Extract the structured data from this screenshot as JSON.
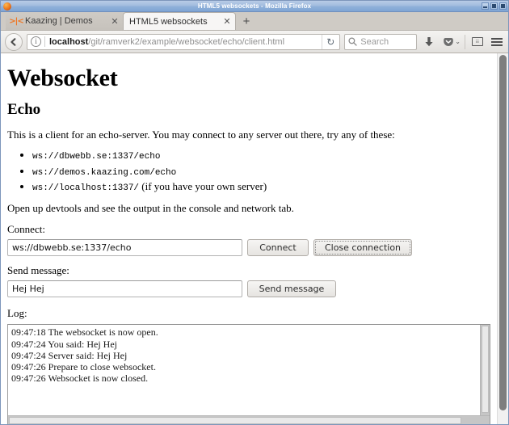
{
  "window": {
    "title": "HTML5 websockets - Mozilla Firefox",
    "minimize_label": "Minimize",
    "maximize_label": "Maximize",
    "close_label": "Close"
  },
  "tabs": [
    {
      "favicon": "kaazing-icon",
      "favicon_glyph": ">|<",
      "label": "Kaazing | Demos",
      "close_glyph": "✕",
      "active": false
    },
    {
      "favicon": "page-icon",
      "favicon_glyph": "",
      "label": "HTML5 websockets",
      "close_glyph": "✕",
      "active": true
    }
  ],
  "newtab": {
    "glyph": "+",
    "label": "New Tab"
  },
  "toolbar": {
    "back_label": "Back",
    "identity_glyph": "i",
    "url_host": "localhost",
    "url_path": "/git/ramverk2/example/websocket/echo/client.html",
    "reload_glyph": "↻",
    "reload_label": "Reload",
    "search_placeholder": "Search",
    "downloads_label": "Downloads",
    "pocket_label": "Save to Pocket",
    "pocket_chevron": "⌄",
    "reader_label": "Reader view",
    "reader_glyph": "☷",
    "menu_label": "Open menu"
  },
  "page": {
    "h1": "Websocket",
    "h2": "Echo",
    "intro": "This is a client for an echo-server. You may connect to any server out there, try any of these:",
    "servers": [
      {
        "url": "ws://dbwebb.se:1337/echo",
        "note": ""
      },
      {
        "url": "ws://demos.kaazing.com/echo",
        "note": ""
      },
      {
        "url": "ws://localhost:1337/",
        "note": "(if you have your own server)"
      }
    ],
    "devtools_note": "Open up devtools and see the output in the console and network tab.",
    "connect_label": "Connect:",
    "connect_value": "ws://dbwebb.se:1337/echo",
    "connect_placeholder": "",
    "connect_button": "Connect",
    "close_button": "Close connection",
    "send_label": "Send message:",
    "message_value": "Hej Hej",
    "message_placeholder": "",
    "send_button": "Send message",
    "log_label": "Log:",
    "log_lines": [
      "09:47:18 The websocket is now open.",
      "09:47:24 You said: Hej Hej",
      "09:47:24 Server said: Hej Hej",
      "09:47:26 Prepare to close websocket.",
      "09:47:26 Websocket is now closed."
    ]
  },
  "colors": {
    "titlebar_blue": "#8fb0d9",
    "tabstrip_gray": "#cfcbc5",
    "active_tab": "#f7f6f5",
    "kaazing_orange": "#ee7624",
    "page_bg": "#ffffff"
  }
}
